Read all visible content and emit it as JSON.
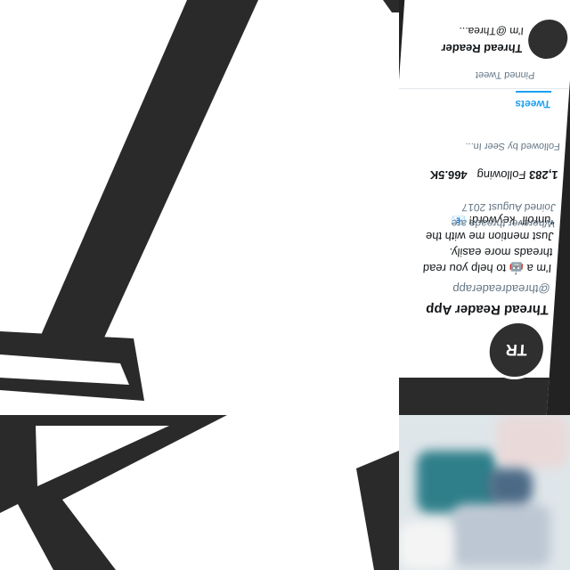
{
  "profile": {
    "name": "Thread Reader App",
    "handle": "@threadreaderapp",
    "bio_line1": "I'm a 🤖 to help you read threads more easily.",
    "bio_line2": "Just mention me with the \"unroll\" keyword! 📧",
    "location": "Wherever threads are",
    "joined": "Joined August 2017",
    "following_count": "1,283",
    "following_label": "Following",
    "followers_count": "466.5K",
    "followed_by": "Followed by Seer In...",
    "tabs": [
      "Tweets"
    ],
    "pinned_label": "Pinned Tweet",
    "tweet_name": "Thread Reader",
    "tweet_text": "I'm @Threa..."
  },
  "photo": {
    "colors": [
      "#2f7f8a",
      "#e9d9d9",
      "#bdc7d3",
      "#f4f4f4",
      "#4c6a86"
    ]
  }
}
